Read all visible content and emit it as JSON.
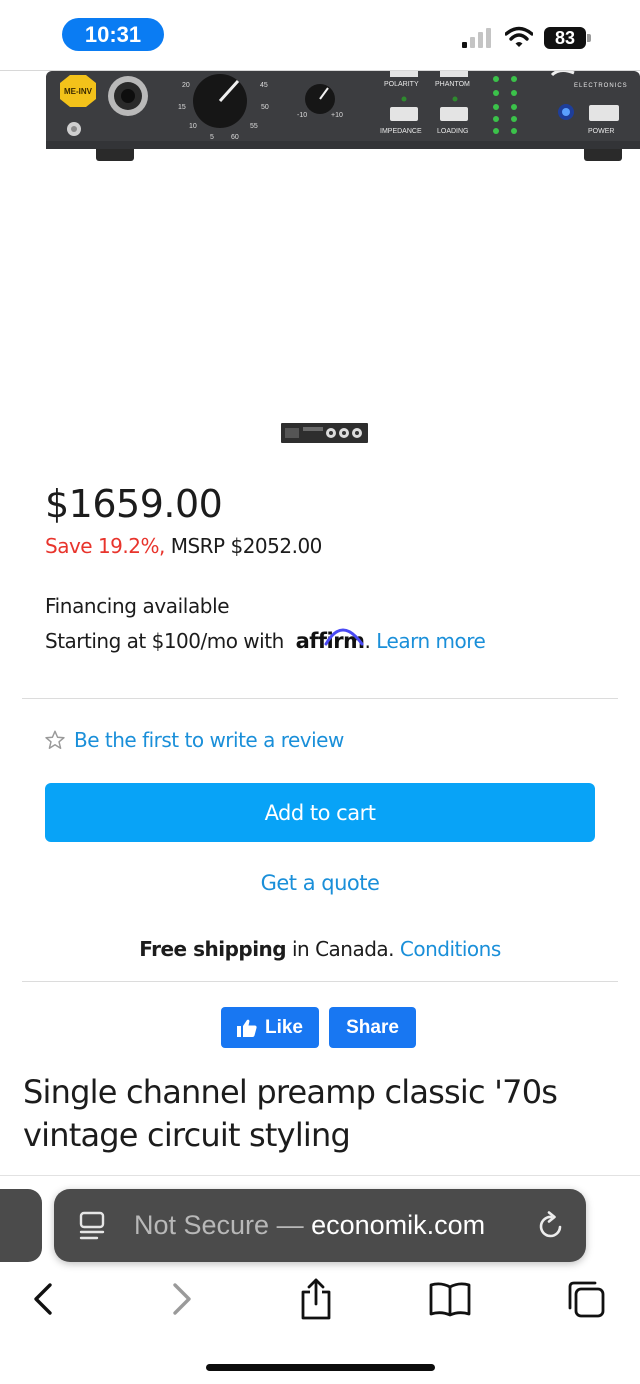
{
  "status_bar": {
    "time": "10:31",
    "battery": "83",
    "icons": [
      "signal-icon",
      "wifi-icon",
      "battery-icon"
    ]
  },
  "product_image": {
    "knob_scale_a": [
      "20",
      "45",
      "15",
      "50",
      "10",
      "55",
      "5",
      "60"
    ],
    "knob_scale_b": [
      "-10",
      "+10"
    ],
    "logo_badge": "ME-INV",
    "brand_fragment": "ELECTRONICS",
    "button_labels": {
      "polarity": "POLARITY",
      "phantom": "PHANTOM",
      "impedance": "IMPEDANCE",
      "loading": "LOADING",
      "power": "POWER"
    }
  },
  "price": {
    "current": "$1659.00",
    "save": "Save 19.2%,",
    "msrp": " MSRP $2052.00"
  },
  "financing": {
    "title": "Financing available",
    "starting": "Starting at $100/mo with ",
    "affirm": "affirm",
    "period": ".",
    "learn_more": " Learn more"
  },
  "review": {
    "link": "Be the first to write a review"
  },
  "actions": {
    "add_to_cart": "Add to cart",
    "get_quote": "Get a quote"
  },
  "shipping": {
    "bold": "Free shipping",
    "rest": " in Canada. ",
    "conditions": "Conditions"
  },
  "social": {
    "like": "Like",
    "share": "Share"
  },
  "headline": "Single channel preamp classic '70s vintage circuit styling",
  "browser": {
    "insecure": "Not Secure — ",
    "domain": "economik.com"
  },
  "colors": {
    "accent_blue": "#08a3f7",
    "link_blue": "#1a8fd9",
    "save_red": "#e8342c",
    "facebook_blue": "#1877f2",
    "status_time_pill": "#0a7cf3"
  }
}
